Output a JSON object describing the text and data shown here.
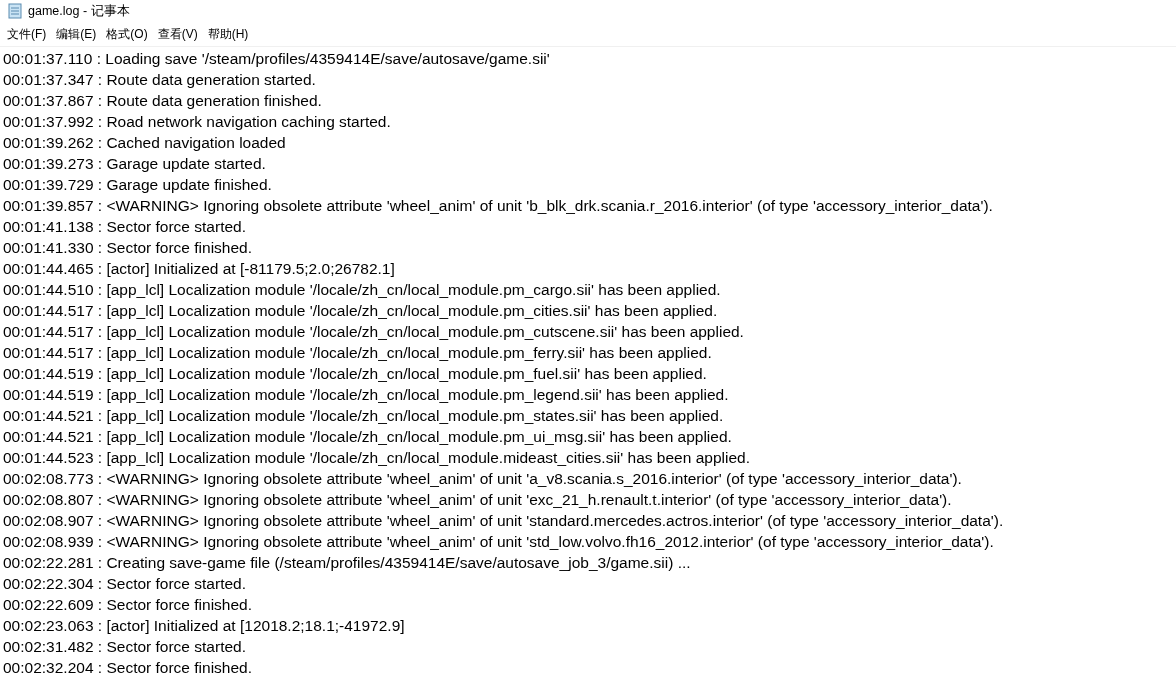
{
  "window": {
    "title": "game.log - 记事本"
  },
  "menu": [
    "文件(F)",
    "编辑(E)",
    "格式(O)",
    "查看(V)",
    "帮助(H)"
  ],
  "lines": [
    "00:01:37.110 : Loading save '/steam/profiles/4359414E/save/autosave/game.sii'",
    "00:01:37.347 : Route data generation started.",
    "00:01:37.867 : Route data generation finished.",
    "00:01:37.992 : Road network navigation caching started.",
    "00:01:39.262 : Cached navigation loaded",
    "00:01:39.273 : Garage update started.",
    "00:01:39.729 : Garage update finished.",
    "00:01:39.857 : <WARNING> Ignoring obsolete attribute 'wheel_anim' of unit 'b_blk_drk.scania.r_2016.interior' (of type 'accessory_interior_data').",
    "00:01:41.138 : Sector force started.",
    "00:01:41.330 : Sector force finished.",
    "00:01:44.465 : [actor] Initialized at [-81179.5;2.0;26782.1]",
    "00:01:44.510 : [app_lcl] Localization module '/locale/zh_cn/local_module.pm_cargo.sii' has been applied.",
    "00:01:44.517 : [app_lcl] Localization module '/locale/zh_cn/local_module.pm_cities.sii' has been applied.",
    "00:01:44.517 : [app_lcl] Localization module '/locale/zh_cn/local_module.pm_cutscene.sii' has been applied.",
    "00:01:44.517 : [app_lcl] Localization module '/locale/zh_cn/local_module.pm_ferry.sii' has been applied.",
    "00:01:44.519 : [app_lcl] Localization module '/locale/zh_cn/local_module.pm_fuel.sii' has been applied.",
    "00:01:44.519 : [app_lcl] Localization module '/locale/zh_cn/local_module.pm_legend.sii' has been applied.",
    "00:01:44.521 : [app_lcl] Localization module '/locale/zh_cn/local_module.pm_states.sii' has been applied.",
    "00:01:44.521 : [app_lcl] Localization module '/locale/zh_cn/local_module.pm_ui_msg.sii' has been applied.",
    "00:01:44.523 : [app_lcl] Localization module '/locale/zh_cn/local_module.mideast_cities.sii' has been applied.",
    "00:02:08.773 : <WARNING> Ignoring obsolete attribute 'wheel_anim' of unit 'a_v8.scania.s_2016.interior' (of type 'accessory_interior_data').",
    "00:02:08.807 : <WARNING> Ignoring obsolete attribute 'wheel_anim' of unit 'exc_21_h.renault.t.interior' (of type 'accessory_interior_data').",
    "00:02:08.907 : <WARNING> Ignoring obsolete attribute 'wheel_anim' of unit 'standard.mercedes.actros.interior' (of type 'accessory_interior_data').",
    "00:02:08.939 : <WARNING> Ignoring obsolete attribute 'wheel_anim' of unit 'std_low.volvo.fh16_2012.interior' (of type 'accessory_interior_data').",
    "00:02:22.281 : Creating save-game file (/steam/profiles/4359414E/save/autosave_job_3/game.sii) ...",
    "00:02:22.304 : Sector force started.",
    "00:02:22.609 : Sector force finished.",
    "00:02:23.063 : [actor] Initialized at [12018.2;18.1;-41972.9]",
    "00:02:31.482 : Sector force started.",
    "00:02:32.204 : Sector force finished."
  ]
}
